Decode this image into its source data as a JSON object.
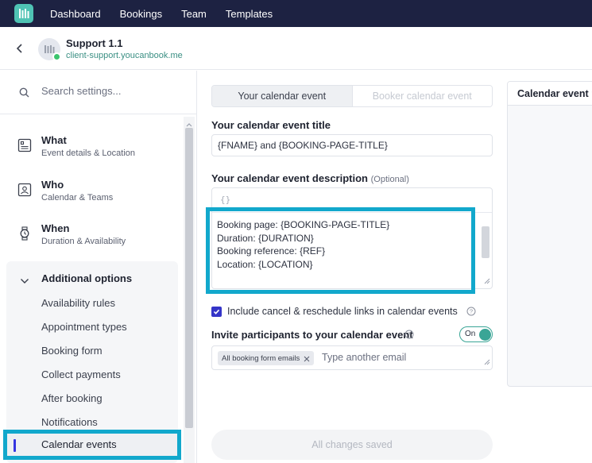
{
  "nav": {
    "items": [
      "Dashboard",
      "Bookings",
      "Team",
      "Templates"
    ]
  },
  "page": {
    "title": "Support 1.1",
    "url": "client-support.youcanbook.me"
  },
  "sidebar": {
    "search_placeholder": "Search settings...",
    "sections": [
      {
        "title": "What",
        "subtitle": "Event details & Location",
        "icon": "document-icon"
      },
      {
        "title": "Who",
        "subtitle": "Calendar & Teams",
        "icon": "person-card-icon"
      },
      {
        "title": "When",
        "subtitle": "Duration & Availability",
        "icon": "watch-icon"
      }
    ],
    "additional": {
      "title": "Additional options",
      "items": [
        "Availability rules",
        "Appointment types",
        "Booking form",
        "Collect payments",
        "After booking",
        "Notifications"
      ],
      "active_item": "Calendar events"
    }
  },
  "main": {
    "tabs": [
      "Your calendar event",
      "Booker calendar event"
    ],
    "event_title_label": "Your calendar event title",
    "event_title_value": "{FNAME} and {BOOKING-PAGE-TITLE}",
    "description_label": "Your calendar event description",
    "description_optional": "(Optional)",
    "description_icon": "{}",
    "description_value": "Booking page: {BOOKING-PAGE-TITLE}\nDuration: {DURATION}\nBooking reference: {REF}\nLocation: {LOCATION}\n\n{FORMFIELDS}",
    "include_links_label": "Include cancel & reschedule links in calendar events",
    "include_links_checked": true,
    "invite_label": "Invite participants to your calendar event",
    "invite_toggle": "On",
    "invite_chip": "All booking form emails",
    "invite_placeholder": "Type another email",
    "save_status": "All changes saved"
  },
  "preview": {
    "title": "Calendar event p"
  },
  "colors": {
    "nav_bg": "#1d2242",
    "brand": "#4fc3b4",
    "highlight": "#12a8cc",
    "checkbox": "#3535c8",
    "toggle": "#3aa596"
  }
}
